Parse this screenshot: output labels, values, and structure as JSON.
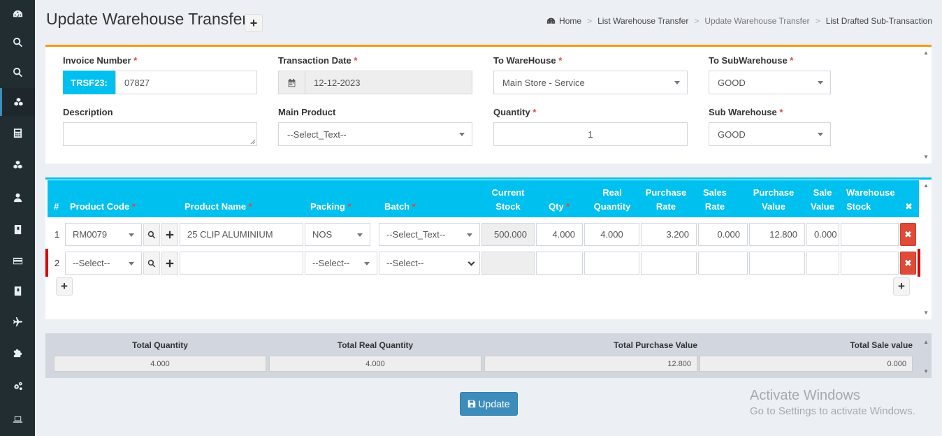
{
  "sidebar": {
    "items": [
      {
        "icon": "dashboard-icon"
      },
      {
        "icon": "search-icon"
      },
      {
        "icon": "search-icon"
      },
      {
        "icon": "cubes-icon",
        "active": true
      },
      {
        "icon": "calculator-icon"
      },
      {
        "icon": "cubes-icon"
      },
      {
        "icon": "user-icon"
      },
      {
        "icon": "book-icon"
      },
      {
        "icon": "credit-card-icon"
      },
      {
        "icon": "book-icon"
      },
      {
        "icon": "plane-icon"
      },
      {
        "icon": "puzzle-icon"
      },
      {
        "icon": "cogs-icon"
      },
      {
        "icon": "laptop-icon"
      }
    ]
  },
  "header": {
    "title": "Update Warehouse Transfer",
    "add_label": "+",
    "breadcrumb": [
      "Home",
      "List Warehouse Transfer",
      "Update Warehouse Transfer",
      "List Drafted Sub-Transaction"
    ]
  },
  "form": {
    "invoice_label": "Invoice Number",
    "invoice_prefix": "TRSF23:",
    "invoice_value": "07827",
    "date_label": "Transaction Date",
    "date_value": "12-12-2023",
    "to_warehouse_label": "To WareHouse",
    "to_warehouse_value": "Main Store - Service",
    "to_subwarehouse_label": "To SubWarehouse",
    "to_subwarehouse_value": "GOOD",
    "description_label": "Description",
    "description_value": "",
    "main_product_label": "Main Product",
    "main_product_value": "--Select_Text--",
    "quantity_label": "Quantity",
    "quantity_value": "1",
    "sub_warehouse_label": "Sub Warehouse",
    "sub_warehouse_value": "GOOD",
    "required_mark": "*"
  },
  "grid": {
    "headers": {
      "num": "#",
      "product_code": "Product Code",
      "product_name": "Product Name",
      "packing": "Packing",
      "batch": "Batch",
      "current_stock_1": "Current",
      "current_stock_2": "Stock",
      "qty": "Qty",
      "real_qty_1": "Real",
      "real_qty_2": "Quantity",
      "purchase_rate_1": "Purchase",
      "purchase_rate_2": "Rate",
      "sales_rate_1": "Sales",
      "sales_rate_2": "Rate",
      "purchase_value_1": "Purchase",
      "purchase_value_2": "Value",
      "sale_value_1": "Sale",
      "sale_value_2": "Value",
      "warehouse_stock_1": "Warehouse",
      "warehouse_stock_2": "Stock",
      "remove": "✖"
    },
    "rows": [
      {
        "num": "1",
        "product_code": "RM0079",
        "product_name": "25 CLIP ALUMINIUM",
        "packing": "NOS",
        "batch": "--Select_Text--",
        "current_stock": "500.000",
        "qty": "4.000",
        "real_qty": "4.000",
        "purchase_rate": "3.200",
        "sales_rate": "0.000",
        "purchase_value": "12.800",
        "sale_value": "0.000",
        "warehouse_stock": ""
      },
      {
        "num": "2",
        "product_code": "--Select--",
        "product_name": "",
        "packing": "--Select--",
        "batch": "--Select--",
        "current_stock": "",
        "qty": "",
        "real_qty": "",
        "purchase_rate": "",
        "sales_rate": "",
        "purchase_value": "",
        "sale_value": "",
        "warehouse_stock": ""
      }
    ],
    "add_row_label": "+"
  },
  "totals": {
    "total_quantity_label": "Total Quantity",
    "total_quantity": "4.000",
    "total_real_quantity_label": "Total Real Quantity",
    "total_real_quantity": "4.000",
    "total_purchase_value_label": "Total Purchase Value",
    "total_purchase_value": "12.800",
    "total_sale_value_label": "Total Sale value",
    "total_sale_value": "0.000"
  },
  "actions": {
    "update_label": "Update"
  },
  "watermark": {
    "line1": "Activate Windows",
    "line2": "Go to Settings to activate Windows."
  },
  "colors": {
    "sidebar_bg": "#222d32",
    "accent_blue": "#00c0ef",
    "primary": "#3c8dbc",
    "warning_border": "#f39c12",
    "danger": "#dd4b39"
  }
}
